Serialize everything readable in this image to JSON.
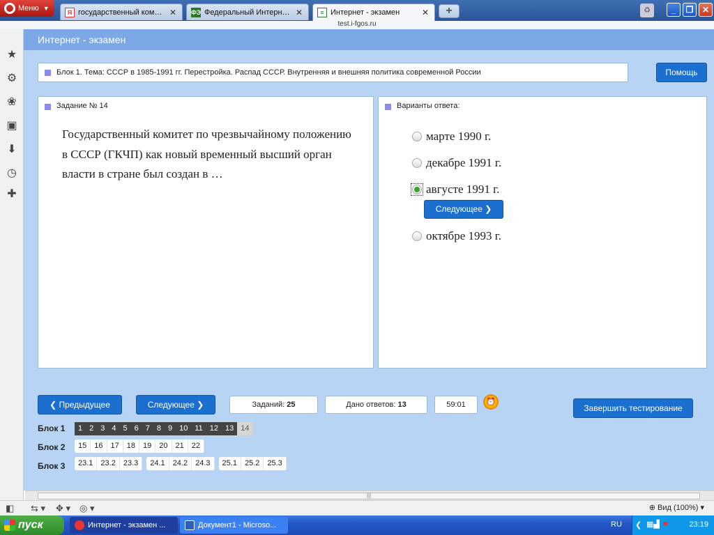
{
  "browser": {
    "menu_label": "Меню",
    "tabs": [
      {
        "title": "государственный коми...",
        "favicon": "Я"
      },
      {
        "title": "Федеральный Интерне...",
        "favicon": "ФЭ"
      },
      {
        "title": "Интернет - экзамен",
        "favicon": "≡"
      }
    ],
    "new_tab_label": "+",
    "close_glyph": "✕",
    "url": "test.i-fgos.ru"
  },
  "page": {
    "header": "Интернет - экзамен",
    "block_title": "Блок 1. Тема: СССР в 1985-1991 гг. Перестройка. Распад СССР. Внутренняя и внешняя политика современной России",
    "help_label": "Помощь",
    "task_label": "Задание № 14",
    "question": "Государственный комитет по чрезвычайному положению в СССР (ГКЧП) как новый временный высший орган власти в стране был создан в …",
    "answers_label": "Варианты ответа:",
    "answers": [
      {
        "text": "марте 1990 г.",
        "checked": false
      },
      {
        "text": "декабре 1991 г.",
        "checked": false
      },
      {
        "text": "августе 1991 г.",
        "checked": true
      },
      {
        "text": "октябре 1993 г.",
        "checked": false
      }
    ],
    "inline_next_label": "Следующее",
    "prev_label": "Предыдущее",
    "next_label": "Следующее",
    "tasks_label": "Заданий:",
    "tasks_count": "25",
    "answered_label": "Дано ответов:",
    "answered_count": "13",
    "timer": "59:01",
    "finish_label": "Завершить тестирование",
    "blocks": [
      {
        "label": "Блок 1",
        "items": [
          "1",
          "2",
          "3",
          "4",
          "5",
          "6",
          "7",
          "8",
          "9",
          "10",
          "11",
          "12",
          "13",
          "14"
        ],
        "current": "14"
      },
      {
        "label": "Блок 2",
        "items": [
          "15",
          "16",
          "17",
          "18",
          "19",
          "20",
          "21",
          "22"
        ]
      },
      {
        "label": "Блок 3",
        "groups": [
          [
            "23.1",
            "23.2",
            "23.3"
          ],
          [
            "24.1",
            "24.2",
            "24.3"
          ],
          [
            "25.1",
            "25.2",
            "25.3"
          ]
        ]
      }
    ]
  },
  "statusbar": {
    "zoom": "Вид (100%)"
  },
  "taskbar": {
    "start_label": "пуск",
    "tasks": [
      {
        "title": "Интернет - экзамен ..."
      },
      {
        "title": "Документ1 - Microso..."
      }
    ],
    "lang": "RU",
    "time": "23:19"
  },
  "colors": {
    "accent": "#1a6fcf",
    "header": "#7da8e8",
    "page_bg": "#b8d4f5"
  }
}
